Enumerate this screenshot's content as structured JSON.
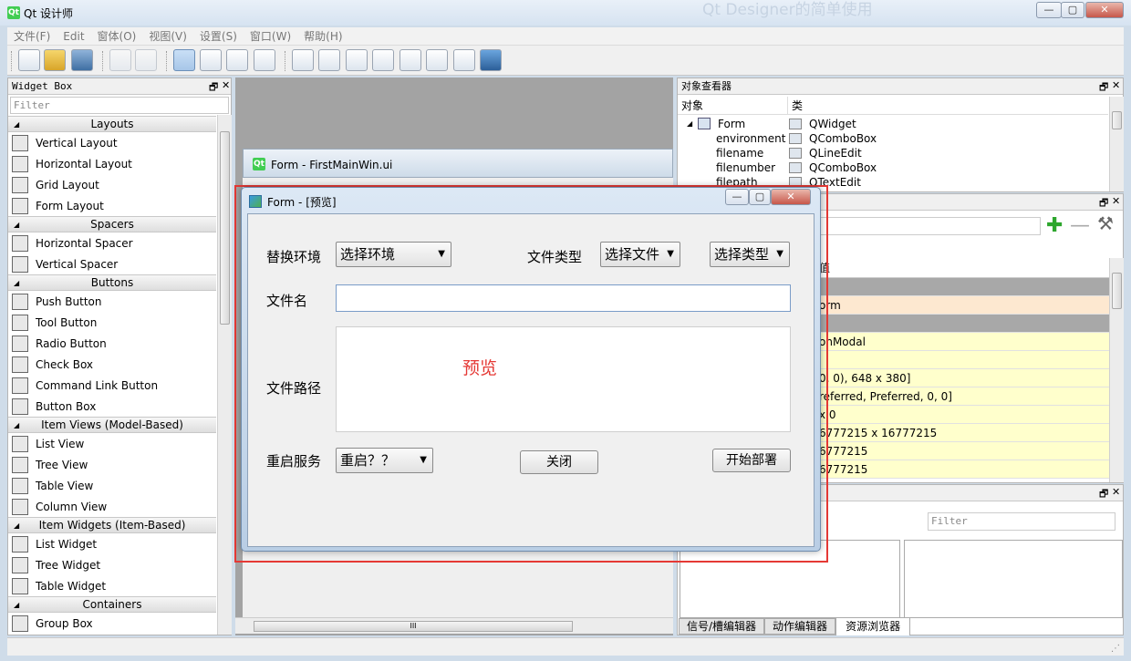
{
  "window": {
    "title": "Qt 设计师",
    "bg_title": "Qt Designer的简单使用"
  },
  "menu": [
    "文件(F)",
    "Edit",
    "窗体(O)",
    "视图(V)",
    "设置(S)",
    "窗口(W)",
    "帮助(H)"
  ],
  "widget_box": {
    "title": "Widget Box",
    "filter_placeholder": "Filter",
    "categories": [
      {
        "name": "Layouts",
        "items": [
          {
            "label": "Vertical Layout",
            "icon": "vertical-layout-icon"
          },
          {
            "label": "Horizontal Layout",
            "icon": "horizontal-layout-icon"
          },
          {
            "label": "Grid Layout",
            "icon": "grid-layout-icon"
          },
          {
            "label": "Form Layout",
            "icon": "form-layout-icon"
          }
        ]
      },
      {
        "name": "Spacers",
        "items": [
          {
            "label": "Horizontal Spacer",
            "icon": "horizontal-spacer-icon"
          },
          {
            "label": "Vertical Spacer",
            "icon": "vertical-spacer-icon"
          }
        ]
      },
      {
        "name": "Buttons",
        "items": [
          {
            "label": "Push Button",
            "icon": "push-button-icon"
          },
          {
            "label": "Tool Button",
            "icon": "tool-button-icon"
          },
          {
            "label": "Radio Button",
            "icon": "radio-button-icon"
          },
          {
            "label": "Check Box",
            "icon": "check-box-icon"
          },
          {
            "label": "Command Link Button",
            "icon": "command-link-icon"
          },
          {
            "label": "Button Box",
            "icon": "button-box-icon"
          }
        ]
      },
      {
        "name": "Item Views (Model-Based)",
        "items": [
          {
            "label": "List View",
            "icon": "list-view-icon"
          },
          {
            "label": "Tree View",
            "icon": "tree-view-icon"
          },
          {
            "label": "Table View",
            "icon": "table-view-icon"
          },
          {
            "label": "Column View",
            "icon": "column-view-icon"
          }
        ]
      },
      {
        "name": "Item Widgets (Item-Based)",
        "items": [
          {
            "label": "List Widget",
            "icon": "list-widget-icon"
          },
          {
            "label": "Tree Widget",
            "icon": "tree-widget-icon"
          },
          {
            "label": "Table Widget",
            "icon": "table-widget-icon"
          }
        ]
      },
      {
        "name": "Containers",
        "items": [
          {
            "label": "Group Box",
            "icon": "group-box-icon"
          }
        ]
      }
    ]
  },
  "mdi": {
    "form_title": "Form - FirstMainWin.ui",
    "scroll_mark": "III"
  },
  "preview": {
    "title": "Form - [预览]",
    "env_label": "替换环境",
    "env_value": "选择环境",
    "filetype_label": "文件类型",
    "file_value": "选择文件",
    "type_value": "选择类型",
    "filename_label": "文件名",
    "path_label": "文件路径",
    "watermark": "预览",
    "restart_label": "重启服务",
    "restart_value": "重启？？",
    "close_btn": "关闭",
    "deploy_btn": "开始部署"
  },
  "object_inspector": {
    "title": "对象查看器",
    "col_object": "对象",
    "col_class": "类",
    "rows": [
      {
        "object": "Form",
        "class": "QWidget"
      },
      {
        "object": "environment",
        "class": "QComboBox"
      },
      {
        "object": "filename",
        "class": "QLineEdit"
      },
      {
        "object": "filenumber",
        "class": "QComboBox"
      },
      {
        "object": "filepath",
        "class": "QTextEdit"
      }
    ]
  },
  "property_editor": {
    "header_fragment": "值",
    "rows": [
      "",
      "orm",
      "",
      "onModal",
      "",
      "0, 0), 648 x 380]",
      "referred, Preferred, 0, 0]",
      "x 0",
      "6777215 x 16777215",
      "6777215",
      "6777215"
    ]
  },
  "resource_browser": {
    "filter_placeholder": "Filter",
    "tabs": [
      "信号/槽编辑器",
      "动作编辑器",
      "资源浏览器"
    ]
  },
  "colors": {
    "highlight_red": "#e53935",
    "prop_yellow": "#ffffcc",
    "prop_peach": "#fde8d0",
    "prop_gray": "#a8a8a8"
  }
}
